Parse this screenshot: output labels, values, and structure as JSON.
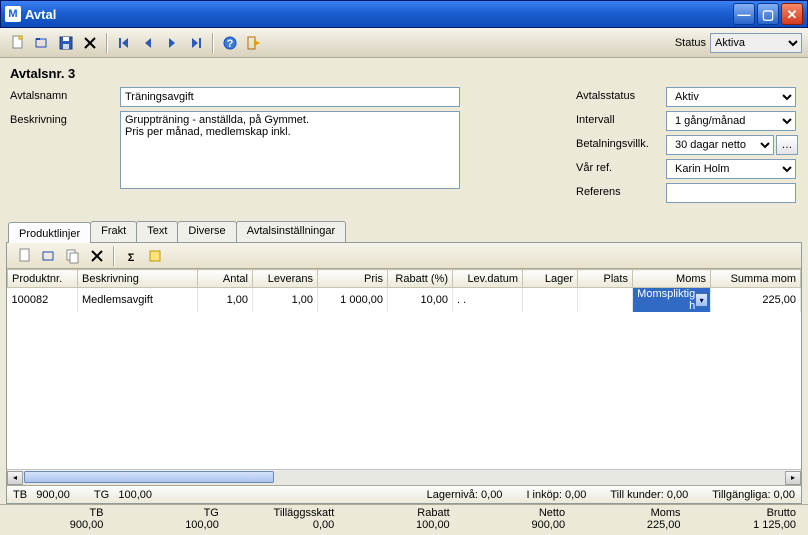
{
  "window": {
    "title": "Avtal",
    "status_label": "Status",
    "status_value": "Aktiva"
  },
  "header": {
    "avtalsnr": "Avtalsnr. 3"
  },
  "labels": {
    "avtalsnamn": "Avtalsnamn",
    "beskrivning": "Beskrivning",
    "avtalsstatus": "Avtalsstatus",
    "intervall": "Intervall",
    "betalningsvillk": "Betalningsvillk.",
    "var_ref": "Vår ref.",
    "referens": "Referens"
  },
  "fields": {
    "avtalsnamn": "Träningsavgift",
    "beskrivning": "Gruppträning - anställda, på Gymmet.\nPris per månad, medlemskap inkl.",
    "avtalsstatus": "Aktiv",
    "intervall": "1 gång/månad",
    "betalningsvillk": "30 dagar netto",
    "var_ref": "Karin Holm",
    "referens": ""
  },
  "tabs": [
    "Produktlinjer",
    "Frakt",
    "Text",
    "Diverse",
    "Avtalsinställningar"
  ],
  "grid": {
    "columns": [
      "Produktnr.",
      "Beskrivning",
      "Antal",
      "Leverans",
      "Pris",
      "Rabatt (%)",
      "Lev.datum",
      "Lager",
      "Plats",
      "Moms",
      "Summa mom"
    ],
    "rows": [
      {
        "produktnr": "100082",
        "beskrivning": "Medlemsavgift",
        "antal": "1,00",
        "leverans": "1,00",
        "pris": "1 000,00",
        "rabatt": "10,00",
        "levdatum": ".  .",
        "lager": "",
        "plats": "",
        "moms": "Momspliktig h",
        "summa": "225,00"
      }
    ]
  },
  "status1": {
    "tb_label": "TB",
    "tb_value": "900,00",
    "tg_label": "TG",
    "tg_value": "100,00",
    "lagerniva": "Lagernivå: 0,00",
    "inköp": "I inköp: 0,00",
    "tillkunder": "Till kunder: 0,00",
    "tillgangliga": "Tillgängliga: 0,00"
  },
  "totals": [
    {
      "lbl": "TB",
      "val": "900,00"
    },
    {
      "lbl": "TG",
      "val": "100,00"
    },
    {
      "lbl": "Tilläggsskatt",
      "val": "0,00"
    },
    {
      "lbl": "Rabatt",
      "val": "100,00"
    },
    {
      "lbl": "Netto",
      "val": "900,00"
    },
    {
      "lbl": "Moms",
      "val": "225,00"
    },
    {
      "lbl": "Brutto",
      "val": "1 125,00"
    }
  ]
}
